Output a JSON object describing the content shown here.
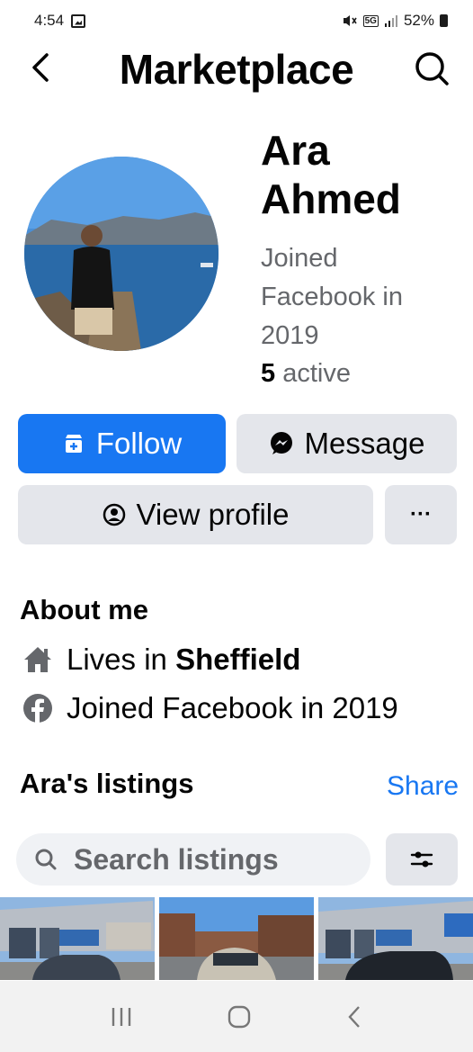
{
  "status_bar": {
    "time": "4:54",
    "network": "5G",
    "battery": "52%"
  },
  "header": {
    "title": "Marketplace"
  },
  "profile": {
    "first_name": "Ara",
    "last_name": "Ahmed",
    "joined_line1": "Joined",
    "joined_line2": "Facebook in",
    "joined_line3": "2019",
    "active_count": "5",
    "active_label": " active"
  },
  "actions": {
    "follow_label": "Follow",
    "message_label": "Message",
    "view_profile_label": "View profile",
    "more_label": "···"
  },
  "about": {
    "heading": "About me",
    "lives_prefix": "Lives in ",
    "lives_city": "Sheffield",
    "joined_text": "Joined Facebook in 2019"
  },
  "listings": {
    "heading": "Ara's listings",
    "share_label": "Share",
    "search_placeholder": "Search listings"
  },
  "colors": {
    "accent": "#1877f2",
    "secondary_button": "#e4e6eb",
    "muted_text": "#65676b"
  },
  "icons": [
    "back-icon",
    "search-icon",
    "shop-follow-icon",
    "messenger-icon",
    "profile-icon",
    "more-icon",
    "home-icon",
    "facebook-icon",
    "filter-icon"
  ]
}
